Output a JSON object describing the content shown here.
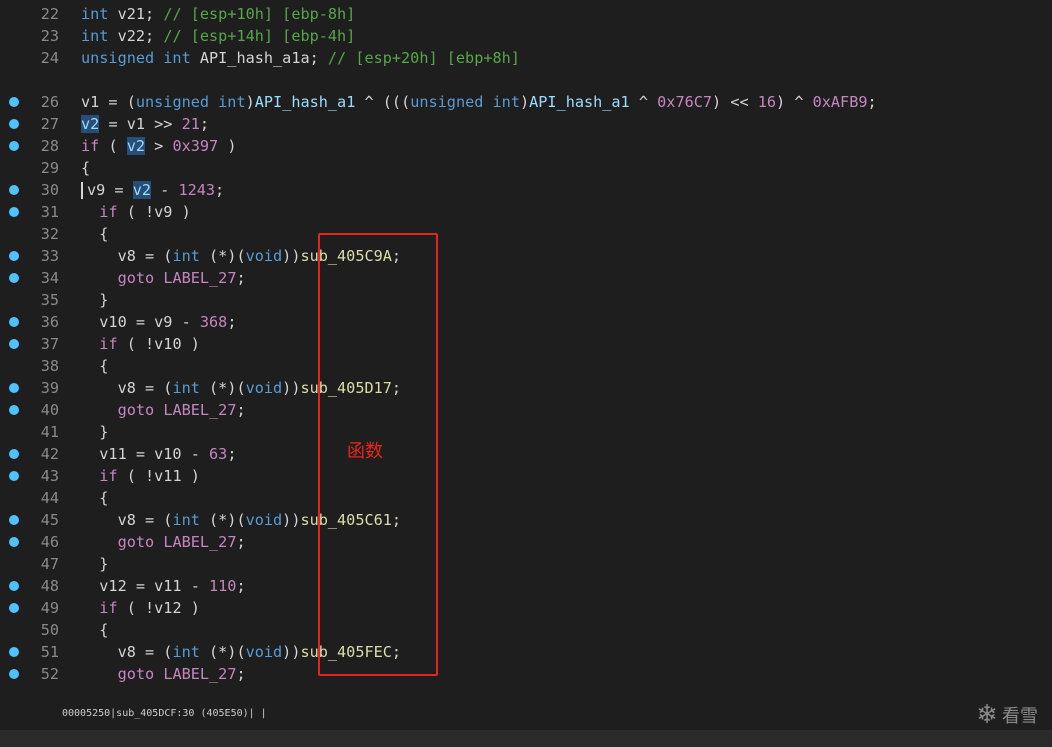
{
  "code": {
    "lines": [
      {
        "num": "22",
        "bp": false,
        "html": "<span class=\"ty\">int</span> v21; <span class=\"cm\">// [esp+10h] [ebp-8h]</span>"
      },
      {
        "num": "23",
        "bp": false,
        "html": "<span class=\"ty\">int</span> v22; <span class=\"cm\">// [esp+14h] [ebp-4h]</span>"
      },
      {
        "num": "24",
        "bp": false,
        "html": "<span class=\"ty\">unsigned int</span> API_hash_a1a; <span class=\"cm\">// [esp+20h] [ebp+8h]</span>"
      },
      {
        "num": "",
        "bp": false,
        "html": ""
      },
      {
        "num": "26",
        "bp": true,
        "html": "v1 = (<span class=\"ty\">unsigned int</span>)<span class=\"id\">API_hash_a1</span> ^ (((<span class=\"ty\">unsigned int</span>)<span class=\"id\">API_hash_a1</span> ^ <span class=\"num\">0x76C7</span>) &lt;&lt; <span class=\"num\">16</span>) ^ <span class=\"num\">0xAFB9</span>;"
      },
      {
        "num": "27",
        "bp": true,
        "html": "<span class=\"hl\">v2</span> = v1 &gt;&gt; <span class=\"num\">21</span>;"
      },
      {
        "num": "28",
        "bp": true,
        "html": "<span class=\"kw\">if</span> ( <span class=\"hl\">v2</span> &gt; <span class=\"num\">0x397</span> )"
      },
      {
        "num": "29",
        "bp": false,
        "html": "{"
      },
      {
        "num": "30",
        "bp": true,
        "html": "<span class=\"cursor\"></span>v9 = <span class=\"hl\">v2</span> - <span class=\"num\">1243</span>;"
      },
      {
        "num": "31",
        "bp": true,
        "html": "  <span class=\"kw\">if</span> ( !v9 )"
      },
      {
        "num": "32",
        "bp": false,
        "html": "  {"
      },
      {
        "num": "33",
        "bp": true,
        "html": "    v8 = (<span class=\"ty\">int</span> (*)(<span class=\"ty\">void</span>))<span class=\"fn\">sub_405C9A</span>;"
      },
      {
        "num": "34",
        "bp": true,
        "html": "    <span class=\"kw\">goto</span> <span class=\"lbl\">LABEL_27</span>;"
      },
      {
        "num": "35",
        "bp": false,
        "html": "  }"
      },
      {
        "num": "36",
        "bp": true,
        "html": "  v10 = v9 - <span class=\"num\">368</span>;"
      },
      {
        "num": "37",
        "bp": true,
        "html": "  <span class=\"kw\">if</span> ( !v10 )"
      },
      {
        "num": "38",
        "bp": false,
        "html": "  {"
      },
      {
        "num": "39",
        "bp": true,
        "html": "    v8 = (<span class=\"ty\">int</span> (*)(<span class=\"ty\">void</span>))<span class=\"fn\">sub_405D17</span>;"
      },
      {
        "num": "40",
        "bp": true,
        "html": "    <span class=\"kw\">goto</span> <span class=\"lbl\">LABEL_27</span>;"
      },
      {
        "num": "41",
        "bp": false,
        "html": "  }"
      },
      {
        "num": "42",
        "bp": true,
        "html": "  v11 = v10 - <span class=\"num\">63</span>;"
      },
      {
        "num": "43",
        "bp": true,
        "html": "  <span class=\"kw\">if</span> ( !v11 )"
      },
      {
        "num": "44",
        "bp": false,
        "html": "  {"
      },
      {
        "num": "45",
        "bp": true,
        "html": "    v8 = (<span class=\"ty\">int</span> (*)(<span class=\"ty\">void</span>))<span class=\"fn\">sub_405C61</span>;"
      },
      {
        "num": "46",
        "bp": true,
        "html": "    <span class=\"kw\">goto</span> <span class=\"lbl\">LABEL_27</span>;"
      },
      {
        "num": "47",
        "bp": false,
        "html": "  }"
      },
      {
        "num": "48",
        "bp": true,
        "html": "  v12 = v11 - <span class=\"num\">110</span>;"
      },
      {
        "num": "49",
        "bp": true,
        "html": "  <span class=\"kw\">if</span> ( !v12 )"
      },
      {
        "num": "50",
        "bp": false,
        "html": "  {"
      },
      {
        "num": "51",
        "bp": true,
        "html": "    v8 = (<span class=\"ty\">int</span> (*)(<span class=\"ty\">void</span>))<span class=\"fn\">sub_405FEC</span>;"
      },
      {
        "num": "52",
        "bp": true,
        "html": "    <span class=\"kw\">goto</span> <span class=\"lbl\">LABEL_27</span>;"
      }
    ]
  },
  "annotation": {
    "text": "函数",
    "color": "#e8261c"
  },
  "status": {
    "text": "00005250|sub_405DCF:30 (405E50)| |"
  },
  "watermark": {
    "text": "看雪",
    "icon": "snowflake-icon"
  },
  "colors": {
    "background": "#1e1e1e",
    "breakpoint": "#4fc1ff",
    "highlight_box": "#e0261f",
    "keyword": "#c586c0",
    "type": "#569cd6",
    "function": "#dcdcaa",
    "comment": "#57a64a"
  }
}
